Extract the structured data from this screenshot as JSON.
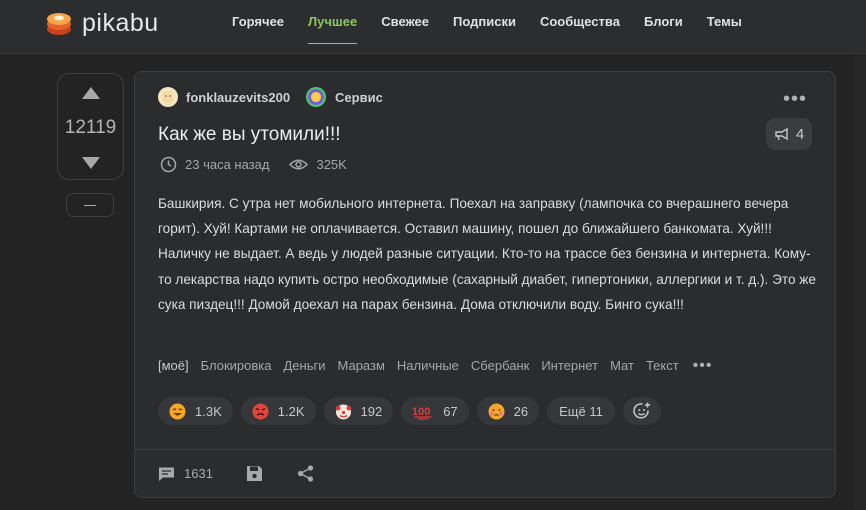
{
  "header": {
    "logo_text": "pikabu",
    "nav": [
      {
        "label": "Горячее"
      },
      {
        "label": "Лучшее"
      },
      {
        "label": "Свежее"
      },
      {
        "label": "Подписки"
      },
      {
        "label": "Сообщества"
      },
      {
        "label": "Блоги"
      },
      {
        "label": "Темы"
      }
    ],
    "active_nav": "Лучшее",
    "accent": "#8ac858"
  },
  "vote": {
    "count": "12119"
  },
  "post": {
    "author": "fonklauzevits200",
    "community": "Сервис",
    "title": "Как же вы утомили!!!",
    "comments_pill": "4",
    "time": "23 часа назад",
    "views": "325K",
    "body": "Башкирия. С утра нет мобильного интернета. Поехал на заправку (лампочка со вчерашнего вечера горит). Хуй! Картами не оплачивается. Оставил машину, пошел до ближайшего банкомата. Хуй!!! Наличку не выдает. А ведь у людей разные ситуации. Кто-то на трассе без бензина и интернета. Кому-то лекарства надо купить остро необходимые (сахарный диабет, гипертоники, аллергики и т. д.). Это же сука пиздец!!! Домой доехал на парах бензина. Дома отключили воду. Бинго сука!!!",
    "tags": [
      "[моё]",
      "Блокировка",
      "Деньги",
      "Маразм",
      "Наличные",
      "Сбербанк",
      "Интернет",
      "Мат",
      "Текст"
    ],
    "reactions": [
      {
        "icon": "laughing-emoji-icon",
        "count": "1.3K",
        "color": "#f4a72a"
      },
      {
        "icon": "angry-emoji-icon",
        "count": "1.2K",
        "color": "#e0453a"
      },
      {
        "icon": "clown-emoji-icon",
        "count": "192",
        "color": "#f2e6da"
      },
      {
        "icon": "hundred-emoji-icon",
        "count": "67",
        "color": "#e23a3a"
      },
      {
        "icon": "sad-emoji-icon",
        "count": "26",
        "color": "#f4a72a"
      }
    ],
    "more_reactions": "Ещё 11",
    "comments_count": "1631"
  }
}
